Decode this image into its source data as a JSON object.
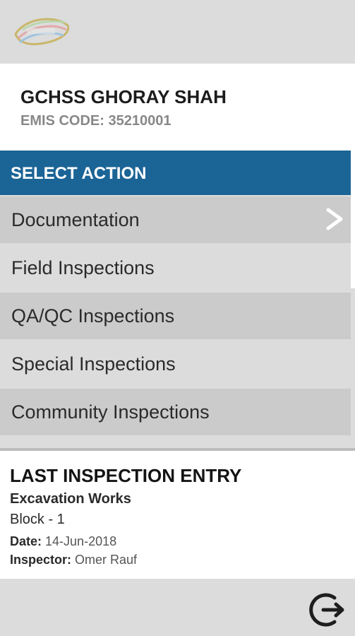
{
  "logo": {
    "icon": "app-logo-icon"
  },
  "school": {
    "name": "GCHSS GHORAY SHAH",
    "emis_code": "EMIS CODE: 35210001"
  },
  "action": {
    "header": "SELECT ACTION"
  },
  "menu": [
    {
      "label": "Documentation",
      "bg": "#cbcbcb"
    },
    {
      "label": "Field Inspections",
      "bg": "#dcdcdc"
    },
    {
      "label": "QA/QC Inspections",
      "bg": "#cbcbcb"
    },
    {
      "label": "Special Inspections",
      "bg": "#dcdcdc"
    },
    {
      "label": "Community Inspections",
      "bg": "#cbcbcb"
    }
  ],
  "last_entry": {
    "title": "LAST INSPECTION ENTRY",
    "work": "Excavation Works",
    "block": "Block - 1",
    "date_label": "Date:",
    "date": "14-Jun-2018",
    "inspector_label": "Inspector:",
    "inspector": "Omer Rauf"
  },
  "colors": {
    "header_blue": "#1b6496",
    "chevron": "#ffffff"
  },
  "icons": {
    "chevron": "chevron-right-icon",
    "refresh": "refresh-icon"
  }
}
